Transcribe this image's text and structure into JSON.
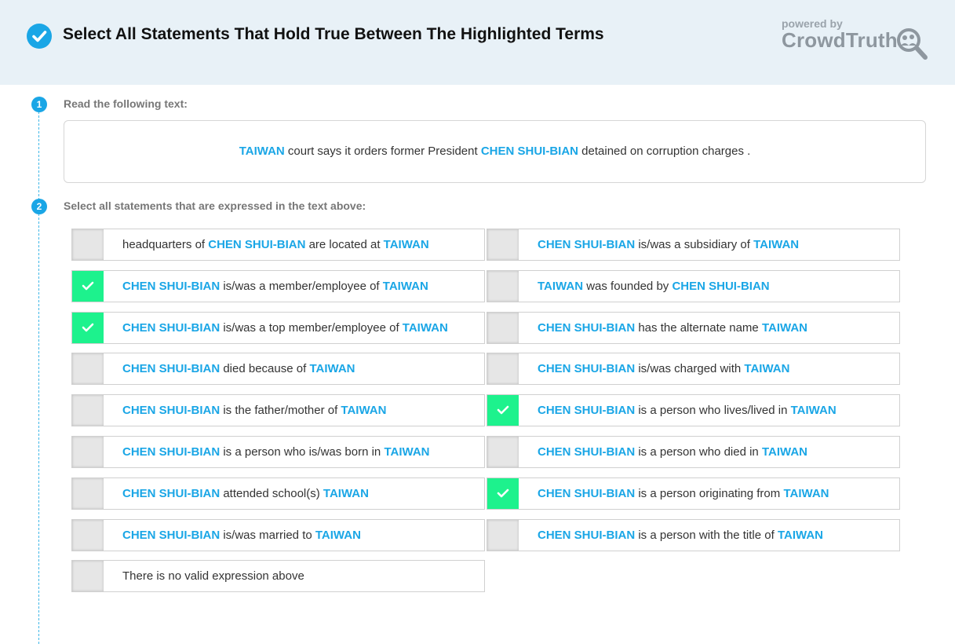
{
  "header": {
    "title": "Select All Statements That Hold True Between The Highlighted Terms",
    "logo_powered": "powered by",
    "logo_name": "CrowdTruth"
  },
  "steps": [
    {
      "number": "1",
      "label": "Read the following text:"
    },
    {
      "number": "2",
      "label": "Select all statements that are expressed in the text above:"
    }
  ],
  "sentence": {
    "term1": "TAIWAN",
    "part1": " court says it orders former President ",
    "term2": "CHEN SHUI-BIAN",
    "part2": " detained on corruption charges ."
  },
  "colors": {
    "accent": "#1aa6e6",
    "checked": "#1df28d",
    "header_bg": "#e8f1f7"
  },
  "options": [
    {
      "pre": "headquarters of ",
      "a": "CHEN SHUI-BIAN",
      "mid": " are located at ",
      "b": "TAIWAN",
      "checked": false
    },
    {
      "pre": "",
      "a": "CHEN SHUI-BIAN",
      "mid": " is/was a subsidiary of ",
      "b": "TAIWAN",
      "checked": false
    },
    {
      "pre": "",
      "a": "CHEN SHUI-BIAN",
      "mid": " is/was a member/employee of ",
      "b": "TAIWAN",
      "checked": true
    },
    {
      "pre": "",
      "a": "TAIWAN",
      "mid": " was founded by ",
      "b": "CHEN SHUI-BIAN",
      "checked": false
    },
    {
      "pre": "",
      "a": "CHEN SHUI-BIAN",
      "mid": " is/was a top member/employee of ",
      "b": "TAIWAN",
      "checked": true
    },
    {
      "pre": "",
      "a": "CHEN SHUI-BIAN",
      "mid": " has the alternate name ",
      "b": "TAIWAN",
      "checked": false
    },
    {
      "pre": "",
      "a": "CHEN SHUI-BIAN",
      "mid": " died because of ",
      "b": "TAIWAN",
      "checked": false
    },
    {
      "pre": "",
      "a": "CHEN SHUI-BIAN",
      "mid": " is/was charged with ",
      "b": "TAIWAN",
      "checked": false
    },
    {
      "pre": "",
      "a": "CHEN SHUI-BIAN",
      "mid": " is the father/mother of ",
      "b": "TAIWAN",
      "checked": false
    },
    {
      "pre": "",
      "a": "CHEN SHUI-BIAN",
      "mid": " is a person who lives/lived in ",
      "b": "TAIWAN",
      "checked": true
    },
    {
      "pre": "",
      "a": "CHEN SHUI-BIAN",
      "mid": " is a person who is/was born in ",
      "b": "TAIWAN",
      "checked": false
    },
    {
      "pre": "",
      "a": "CHEN SHUI-BIAN",
      "mid": " is a person who died in ",
      "b": "TAIWAN",
      "checked": false
    },
    {
      "pre": "",
      "a": "CHEN SHUI-BIAN",
      "mid": " attended school(s) ",
      "b": "TAIWAN",
      "checked": false
    },
    {
      "pre": "",
      "a": "CHEN SHUI-BIAN",
      "mid": " is a person originating from ",
      "b": "TAIWAN",
      "checked": true
    },
    {
      "pre": "",
      "a": "CHEN SHUI-BIAN",
      "mid": " is/was married to ",
      "b": "TAIWAN",
      "checked": false
    },
    {
      "pre": "",
      "a": "CHEN SHUI-BIAN",
      "mid": " is a person with the title of ",
      "b": "TAIWAN",
      "checked": false
    },
    {
      "pre": "There is no valid expression above",
      "a": "",
      "mid": "",
      "b": "",
      "checked": false
    }
  ]
}
